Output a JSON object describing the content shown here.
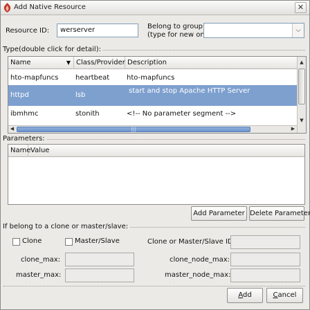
{
  "window": {
    "title": "Add Native Resource",
    "close_glyph": "✕"
  },
  "form": {
    "resource_id_label": "Resource ID:",
    "resource_id_value": "werserver",
    "group_label_line1": "Belong to group:",
    "group_label_line2": "(type for new one)",
    "group_value": ""
  },
  "type_section": {
    "title": "Type(double click for detail):",
    "columns": [
      "Name",
      "Class/Provider",
      "Description"
    ],
    "rows": [
      {
        "name": "hto-mapfuncs",
        "provider": "heartbeat",
        "description": "hto-mapfuncs",
        "selected": false
      },
      {
        "name": "httpd",
        "provider": "lsb",
        "description": "start and stop Apache HTTP Server",
        "selected": true
      },
      {
        "name": "ibmhmc",
        "provider": "stonith",
        "description": "<!-- No parameter segment -->",
        "selected": false
      }
    ],
    "scroll_grip": "|||"
  },
  "parameters": {
    "title": "Parameters:",
    "columns": [
      "Name",
      "Value"
    ],
    "add_button": "Add Parameter",
    "delete_button": "Delete Parameter"
  },
  "clone_section": {
    "title": "If belong to a clone or master/slave:",
    "clone_label": "Clone",
    "master_slave_label": "Master/Slave",
    "clone_or_ms_id_label": "Clone or Master/Slave ID:",
    "clone_max_label": "clone_max:",
    "clone_node_max_label": "clone_node_max:",
    "master_max_label": "master_max:",
    "master_node_max_label": "master_node_max:"
  },
  "footer": {
    "add_mnemonic": "A",
    "add_rest": "dd",
    "cancel_mnemonic": "C",
    "cancel_rest": "ancel"
  },
  "colors": {
    "selection": "#7ea0cf",
    "window_bg": "#eceae6",
    "scroll_thumb": "#6f93c9"
  },
  "icons": [
    "app-icon",
    "close-icon",
    "chevron-down-icon",
    "sort-arrow-icon"
  ]
}
